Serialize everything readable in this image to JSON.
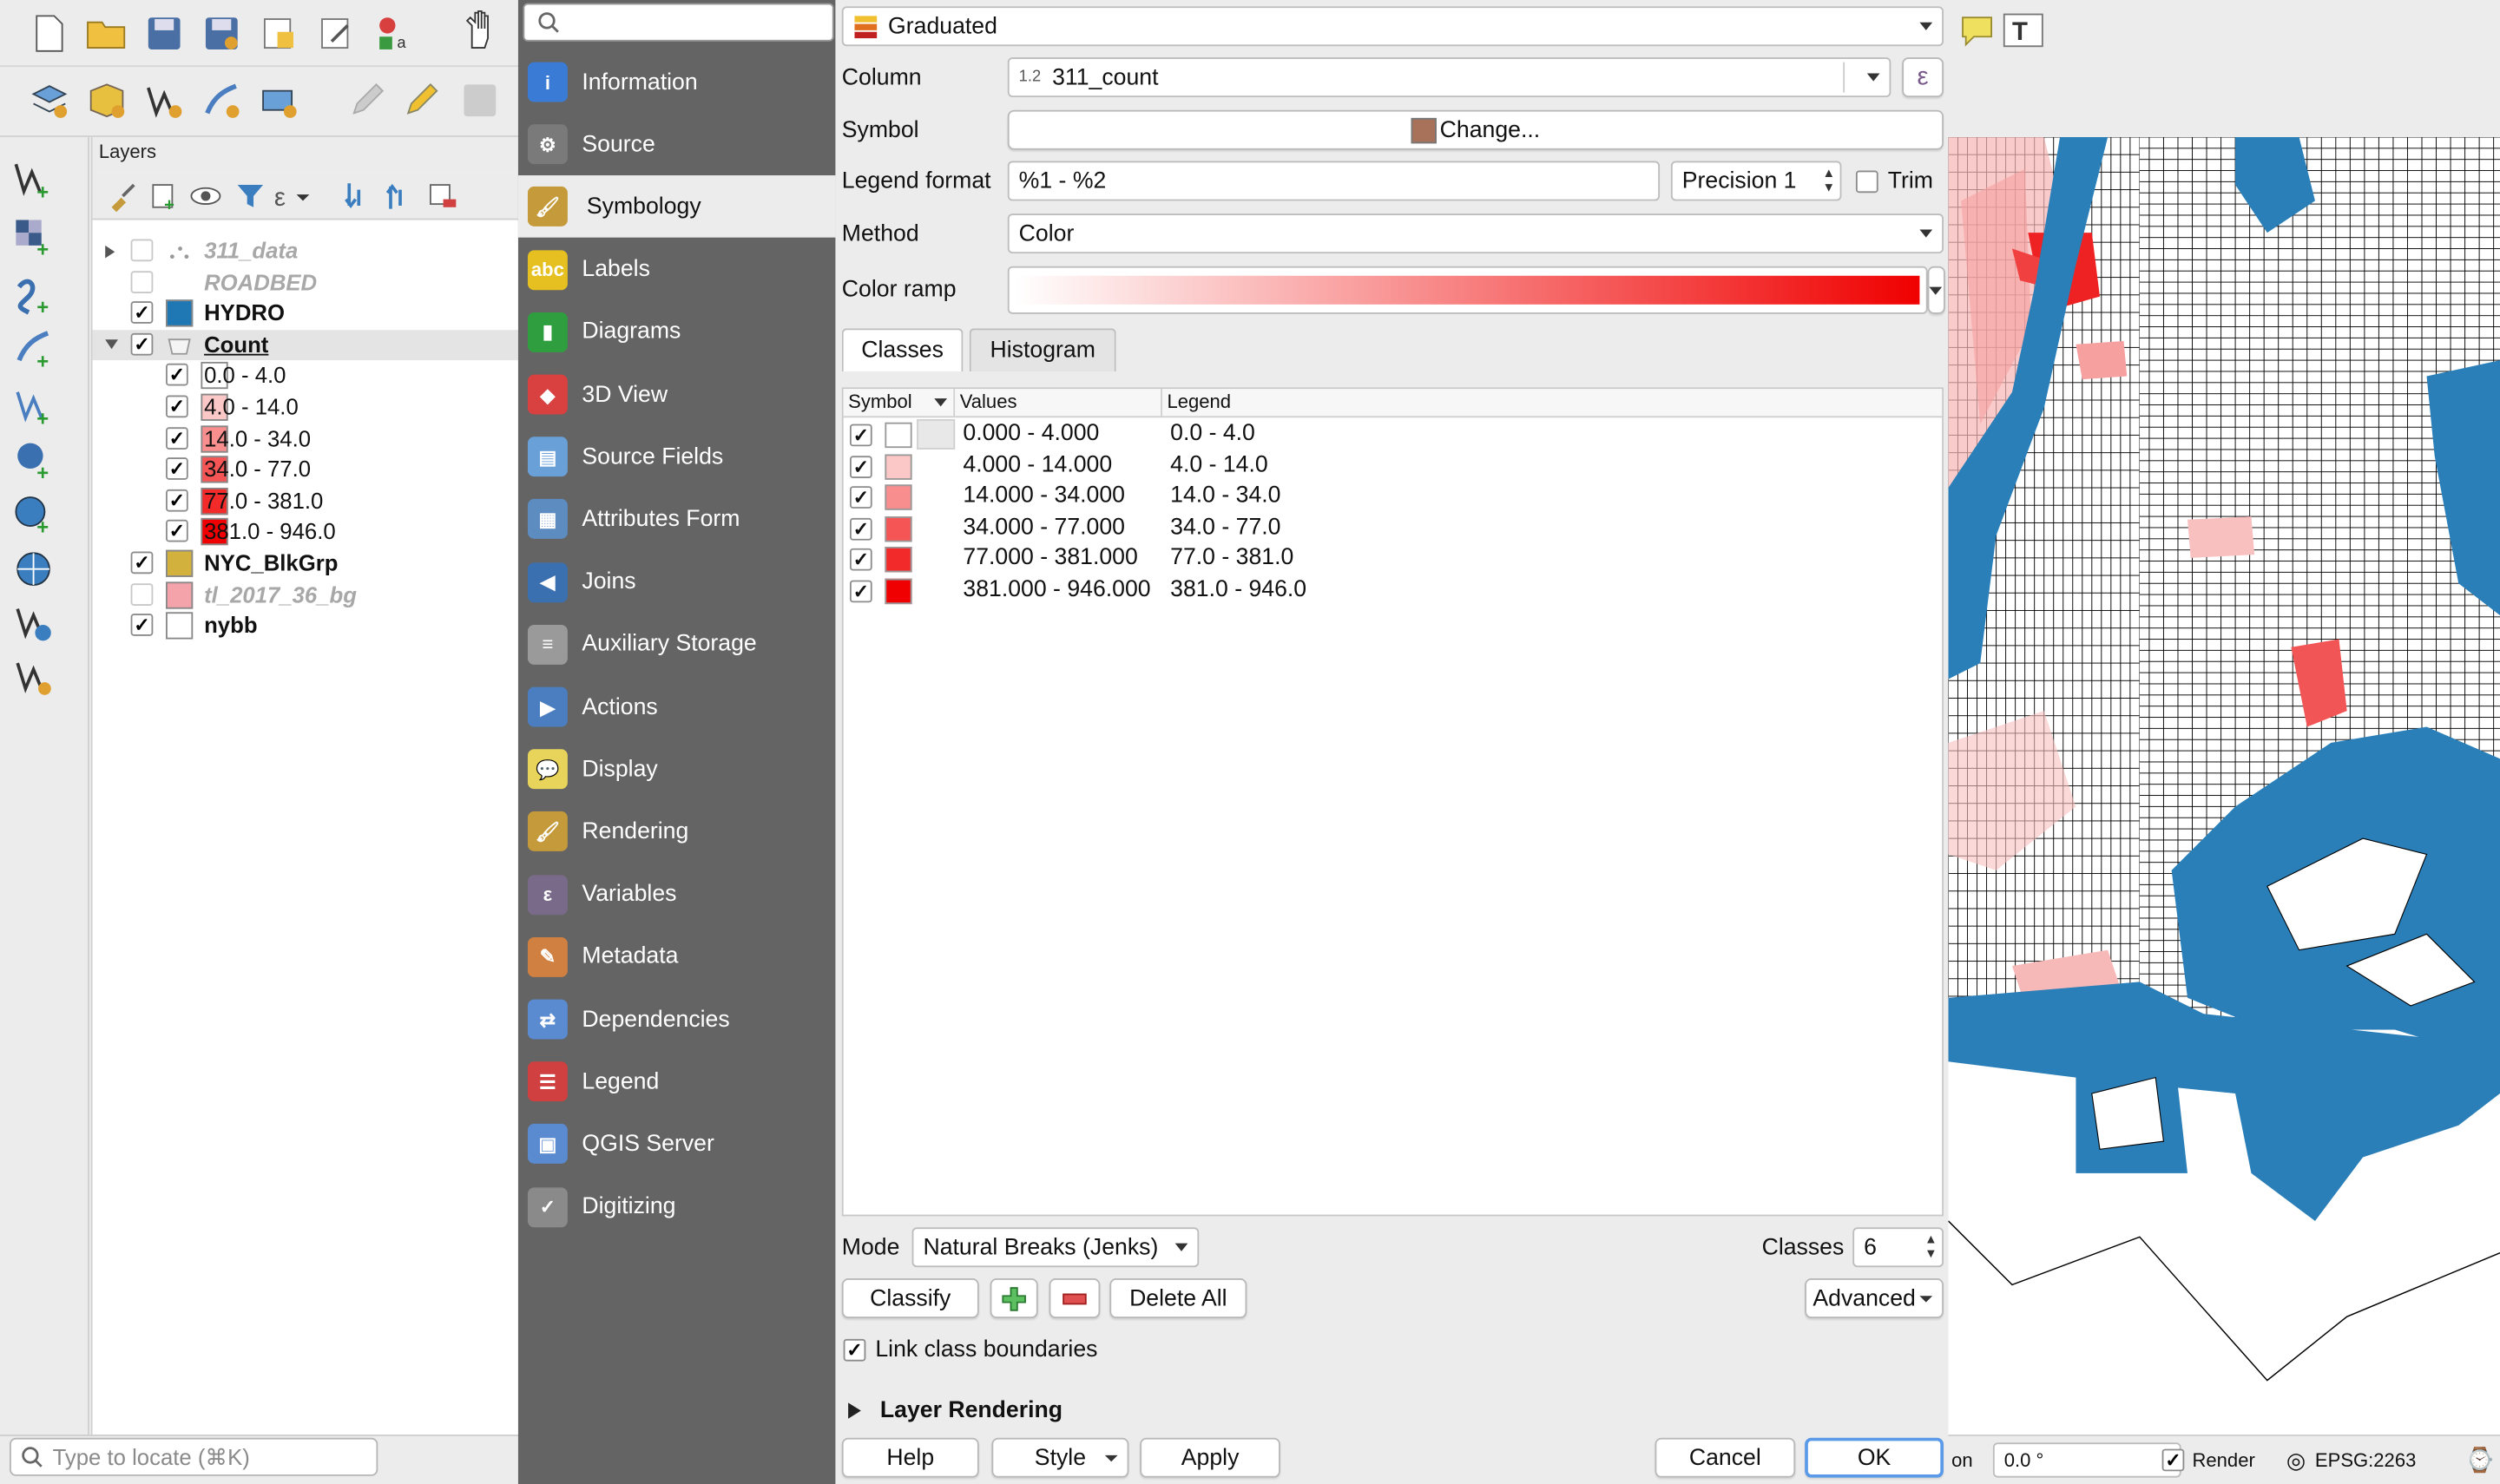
{
  "layers_panel": {
    "title": "Layers",
    "items": [
      {
        "name": "311_data",
        "checked": false,
        "style": "italic-gray",
        "swatch": "dots"
      },
      {
        "name": "ROADBED",
        "checked": false,
        "style": "italic-gray",
        "swatch": "none"
      },
      {
        "name": "HYDRO",
        "checked": true,
        "style": "bold",
        "swatch": "#1f78b4"
      },
      {
        "name": "Count",
        "checked": true,
        "style": "bold-underline",
        "swatch": "polygon"
      },
      {
        "name": "0.0 - 4.0",
        "checked": true,
        "style": "class",
        "swatch": "#ffffff"
      },
      {
        "name": "4.0 - 14.0",
        "checked": true,
        "style": "class",
        "swatch": "#fcc7c7"
      },
      {
        "name": "14.0 - 34.0",
        "checked": true,
        "style": "class",
        "swatch": "#f88e8e"
      },
      {
        "name": "34.0 - 77.0",
        "checked": true,
        "style": "class",
        "swatch": "#f55555"
      },
      {
        "name": "77.0 - 381.0",
        "checked": true,
        "style": "class",
        "swatch": "#f22a2a"
      },
      {
        "name": "381.0 - 946.0",
        "checked": true,
        "style": "class",
        "swatch": "#f00000"
      },
      {
        "name": "NYC_BlkGrp",
        "checked": true,
        "style": "bold",
        "swatch": "#d2b13c"
      },
      {
        "name": "tl_2017_36_bg",
        "checked": false,
        "style": "italic-gray",
        "swatch": "#f5a3ab"
      },
      {
        "name": "nybb",
        "checked": true,
        "style": "bold",
        "swatch": "#ffffff"
      }
    ],
    "locate_placeholder": "Type to locate (⌘K)"
  },
  "nav": {
    "search_placeholder": "",
    "items": [
      {
        "label": "Information",
        "icon": "information-icon",
        "color": "#3a7bd5",
        "glyph": "i"
      },
      {
        "label": "Source",
        "icon": "source-icon",
        "color": "#7a7a7a",
        "glyph": "⚙"
      },
      {
        "label": "Symbology",
        "icon": "symbology-icon",
        "color": "#c49a3a",
        "glyph": "🖌"
      },
      {
        "label": "Labels",
        "icon": "labels-icon",
        "color": "#e6c020",
        "glyph": "abc"
      },
      {
        "label": "Diagrams",
        "icon": "diagrams-icon",
        "color": "#2e9e3e",
        "glyph": "▮"
      },
      {
        "label": "3D View",
        "icon": "3d-view-icon",
        "color": "#d94040",
        "glyph": "◆"
      },
      {
        "label": "Source Fields",
        "icon": "source-fields-icon",
        "color": "#6aa0d8",
        "glyph": "▤"
      },
      {
        "label": "Attributes Form",
        "icon": "attributes-form-icon",
        "color": "#5c8cc0",
        "glyph": "▦"
      },
      {
        "label": "Joins",
        "icon": "joins-icon",
        "color": "#3a6fb0",
        "glyph": "◀"
      },
      {
        "label": "Auxiliary Storage",
        "icon": "auxiliary-storage-icon",
        "color": "#9a9a9a",
        "glyph": "≡"
      },
      {
        "label": "Actions",
        "icon": "actions-icon",
        "color": "#4a7ec0",
        "glyph": "▶"
      },
      {
        "label": "Display",
        "icon": "display-icon",
        "color": "#e8d45a",
        "glyph": "💬"
      },
      {
        "label": "Rendering",
        "icon": "rendering-icon",
        "color": "#c49a3a",
        "glyph": "🖌"
      },
      {
        "label": "Variables",
        "icon": "variables-icon",
        "color": "#7a6a8a",
        "glyph": "ε"
      },
      {
        "label": "Metadata",
        "icon": "metadata-icon",
        "color": "#d08040",
        "glyph": "✎"
      },
      {
        "label": "Dependencies",
        "icon": "dependencies-icon",
        "color": "#5a8ad0",
        "glyph": "⇄"
      },
      {
        "label": "Legend",
        "icon": "legend-icon",
        "color": "#d04040",
        "glyph": "☰"
      },
      {
        "label": "QGIS Server",
        "icon": "qgis-server-icon",
        "color": "#5a8ad0",
        "glyph": "▣"
      },
      {
        "label": "Digitizing",
        "icon": "digitizing-icon",
        "color": "#8a8a8a",
        "glyph": "✓"
      }
    ]
  },
  "symbology": {
    "renderer": "Graduated",
    "column_label": "Column",
    "column_type": "1.2",
    "column_value": "311_count",
    "symbol_label": "Symbol",
    "symbol_button": "Change...",
    "legend_format_label": "Legend format",
    "legend_format_value": "%1 - %2",
    "precision": "Precision 1",
    "trim_label": "Trim",
    "method_label": "Method",
    "method_value": "Color",
    "color_ramp_label": "Color ramp",
    "tabs": [
      "Classes",
      "Histogram"
    ],
    "table_headers": [
      "Symbol",
      "Values",
      "Legend"
    ],
    "classes": [
      {
        "values": "0.000 - 4.000",
        "legend": "0.0 - 4.0",
        "color": "#ffffff"
      },
      {
        "values": "4.000 - 14.000",
        "legend": "4.0 - 14.0",
        "color": "#fcc7c7"
      },
      {
        "values": "14.000 - 34.000",
        "legend": "14.0 - 34.0",
        "color": "#f88e8e"
      },
      {
        "values": "34.000 - 77.000",
        "legend": "34.0 - 77.0",
        "color": "#f55555"
      },
      {
        "values": "77.000 - 381.000",
        "legend": "77.0 - 381.0",
        "color": "#f22a2a"
      },
      {
        "values": "381.000 - 946.000",
        "legend": "381.0 - 946.0",
        "color": "#f00000"
      }
    ],
    "mode_label": "Mode",
    "mode_value": "Natural Breaks (Jenks)",
    "classes_label": "Classes",
    "classes_count": "6",
    "classify_button": "Classify",
    "delete_all_button": "Delete All",
    "advanced_button": "Advanced",
    "link_boundaries_label": "Link class boundaries",
    "layer_rendering_label": "Layer Rendering"
  },
  "footer": {
    "help": "Help",
    "style": "Style",
    "apply": "Apply",
    "cancel": "Cancel",
    "ok": "OK"
  },
  "map_status": {
    "rotation_label": "on",
    "rotation_value": "0.0 °",
    "render_label": "Render",
    "crs": "EPSG:2263"
  },
  "colors": {
    "ramp_start": "#ffffff",
    "ramp_end": "#f00000",
    "water": "#2a7fb8"
  }
}
